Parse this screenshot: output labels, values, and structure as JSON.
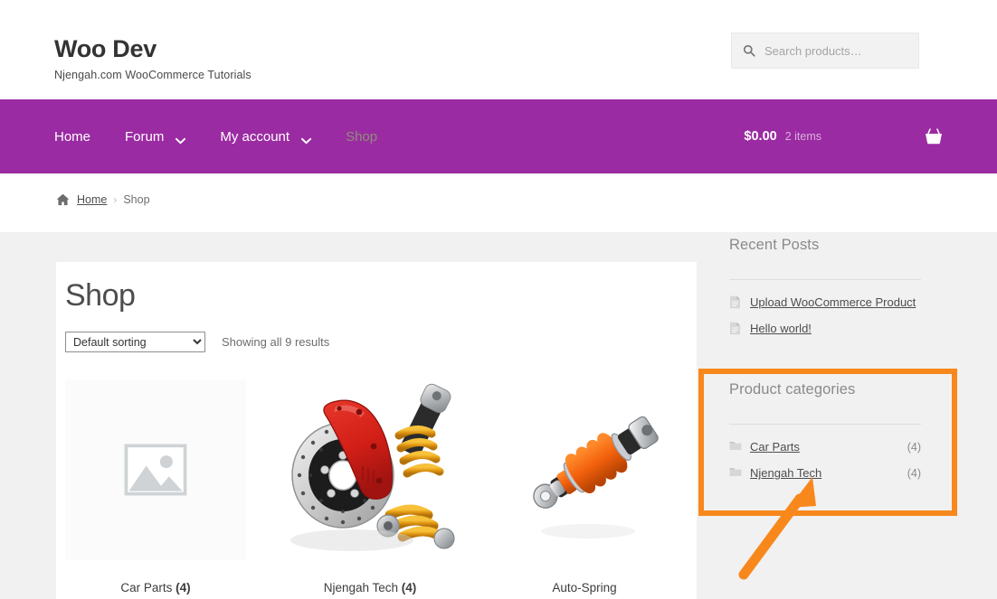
{
  "header": {
    "site_title": "Woo Dev",
    "tagline": "Njengah.com WooCommerce Tutorials",
    "search": {
      "icon": "search-icon",
      "placeholder": "Search products…",
      "value": ""
    }
  },
  "nav": {
    "background_color": "#9b2ba2",
    "items": [
      {
        "label": "Home",
        "has_dropdown": false,
        "current": false
      },
      {
        "label": "Forum",
        "has_dropdown": true,
        "current": false
      },
      {
        "label": "My account",
        "has_dropdown": true,
        "current": false
      },
      {
        "label": "Shop",
        "has_dropdown": false,
        "current": true
      }
    ],
    "cart": {
      "amount": "$0.00",
      "count": "2 items",
      "icon": "shopping-basket-icon"
    }
  },
  "breadcrumb": {
    "home_icon": "home-icon",
    "home_label": "Home",
    "separator": "›",
    "current": "Shop"
  },
  "main": {
    "page_title": "Shop",
    "sorting": {
      "selected": "Default sorting",
      "options": [
        "Default sorting"
      ]
    },
    "result_count": "Showing all 9 results",
    "products": [
      {
        "title_text": "Car Parts",
        "title_count": "(4)",
        "image": "placeholder-image-icon",
        "is_placeholder": true
      },
      {
        "title_text": "Njengah Tech",
        "title_count": "(4)",
        "image": "brake-disc-and-shock-absorber-photo",
        "is_placeholder": false
      },
      {
        "title_text": "Auto-Spring",
        "title_count": "",
        "image": "orange-coilover-shock-photo",
        "is_placeholder": false
      }
    ]
  },
  "sidebar": {
    "recent_posts": {
      "title": "Recent Posts",
      "items": [
        {
          "icon": "document-icon",
          "label": "Upload WooCommerce Product"
        },
        {
          "icon": "document-icon",
          "label": "Hello world!"
        }
      ]
    },
    "product_categories": {
      "title": "Product categories",
      "items": [
        {
          "icon": "folder-icon",
          "label": "Car Parts",
          "count": "(4)"
        },
        {
          "icon": "folder-icon",
          "label": "Njengah Tech",
          "count": "(4)"
        }
      ]
    }
  },
  "annotation": {
    "highlight_color": "#f8881c",
    "shapes": [
      "highlight-rectangle",
      "pointer-arrow"
    ]
  }
}
